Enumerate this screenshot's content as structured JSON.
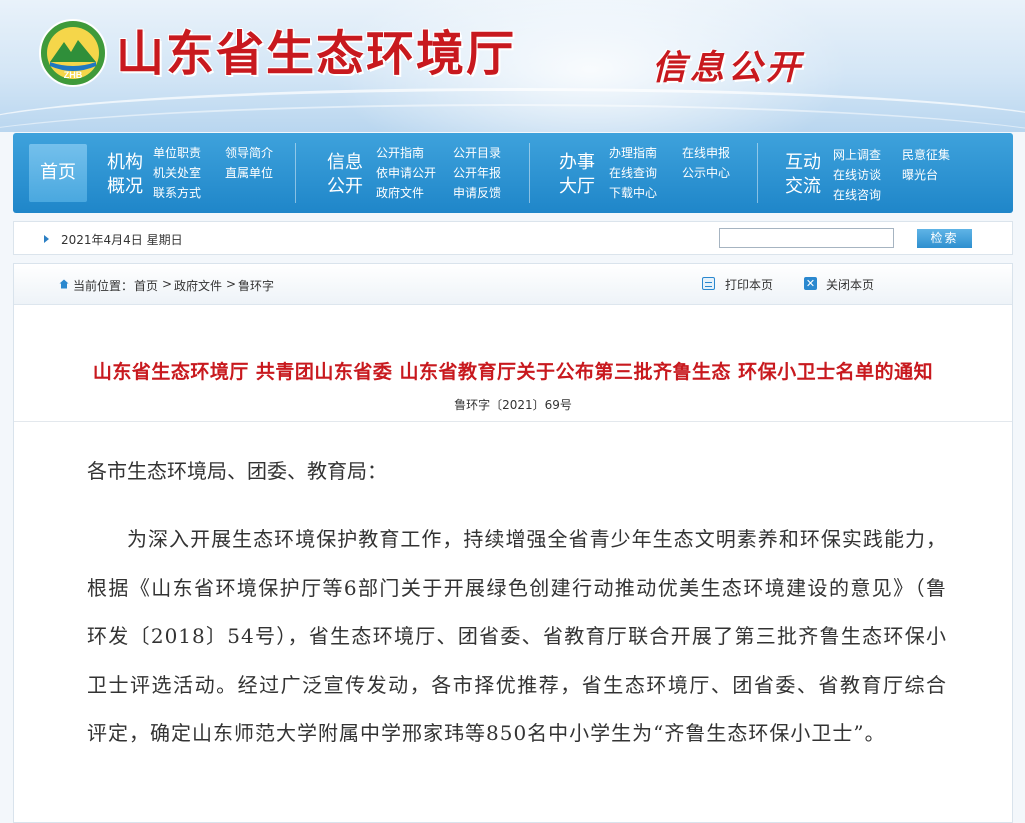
{
  "header": {
    "logo_text": "ZHB",
    "site_title": "山东省生态环境厅",
    "slogan": "信息公开"
  },
  "nav": {
    "home": "首页",
    "groups": [
      {
        "title_line1": "机构",
        "title_line2": "概况",
        "links": [
          "单位职责",
          "领导简介",
          "机关处室",
          "直属单位",
          "联系方式"
        ]
      },
      {
        "title_line1": "信息",
        "title_line2": "公开",
        "links": [
          "公开指南",
          "公开目录",
          "依申请公开",
          "公开年报",
          "政府文件",
          "申请反馈"
        ]
      },
      {
        "title_line1": "办事",
        "title_line2": "大厅",
        "links": [
          "办理指南",
          "在线申报",
          "在线查询",
          "公示中心",
          "下载中心"
        ]
      },
      {
        "title_line1": "互动",
        "title_line2": "交流",
        "links": [
          "网上调查",
          "民意征集",
          "在线访谈",
          "曝光台",
          "在线咨询"
        ]
      }
    ]
  },
  "toolbar": {
    "date": "2021年4月4日  星期日",
    "search_placeholder": "",
    "search_label": "检索"
  },
  "breadcrumb": {
    "prefix": "当前位置：",
    "items": [
      "首页",
      "政府文件",
      "鲁环字"
    ],
    "separator": ">"
  },
  "tools": {
    "print": "打印本页",
    "close": "关闭本页"
  },
  "document": {
    "title": "山东省生态环境厅 共青团山东省委 山东省教育厅关于公布第三批齐鲁生态 环保小卫士名单的通知",
    "number": "鲁环字〔2021〕69号",
    "salutation": "各市生态环境局、团委、教育局：",
    "paragraph": "为深入开展生态环境保护教育工作，持续增强全省青少年生态文明素养和环保实践能力，根据《山东省环境保护厅等6部门关于开展绿色创建行动推动优美生态环境建设的意见》（鲁环发〔2018〕54号），省生态环境厅、团省委、省教育厅联合开展了第三批齐鲁生态环保小卫士评选活动。经过广泛宣传发动，各市择优推荐，省生态环境厅、团省委、省教育厅综合评定，确定山东师范大学附属中学邢家玮等850名中小学生为“齐鲁生态环保小卫士”。"
  },
  "colors": {
    "brand_red": "#c8191e",
    "nav_blue": "#2b90d0"
  }
}
